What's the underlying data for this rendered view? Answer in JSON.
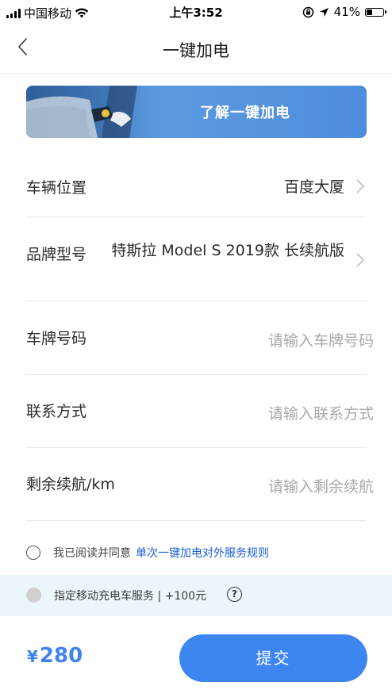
{
  "status_bar": {
    "carrier": "中国移动",
    "time": "上午3:52",
    "battery": "41%",
    "battery_level": 0.41,
    "icons": [
      "signal-icon",
      "wifi-icon",
      "orientation-lock-icon",
      "location-icon",
      "battery-icon"
    ]
  },
  "nav": {
    "title": "一键加电",
    "back_icon": "chevron-left-icon"
  },
  "banner": {
    "text": "了解一键加电"
  },
  "form": {
    "location": {
      "label": "车辆位置",
      "value": "百度大厦"
    },
    "model": {
      "label": "品牌型号",
      "value": "特斯拉 Model S 2019款 长续航版"
    },
    "plate": {
      "label": "车牌号码",
      "placeholder": "请输入车牌号码"
    },
    "contact": {
      "label": "联系方式",
      "placeholder": "请输入联系方式"
    },
    "range": {
      "label": "剩余续航/km",
      "placeholder": "请输入剩余续航"
    }
  },
  "agreement": {
    "text": "我已阅读并同意",
    "link": "单次一键加电对外服务规则"
  },
  "service": {
    "text": "指定移动充电车服务 | +100元",
    "help_icon": "?"
  },
  "footer": {
    "currency": "¥",
    "price": "280",
    "submit": "提交"
  },
  "colors": {
    "accent": "#3d85f0",
    "link": "#1a5fd8",
    "placeholder": "#a9a9a9",
    "service_bg": "#eaf6fa"
  }
}
